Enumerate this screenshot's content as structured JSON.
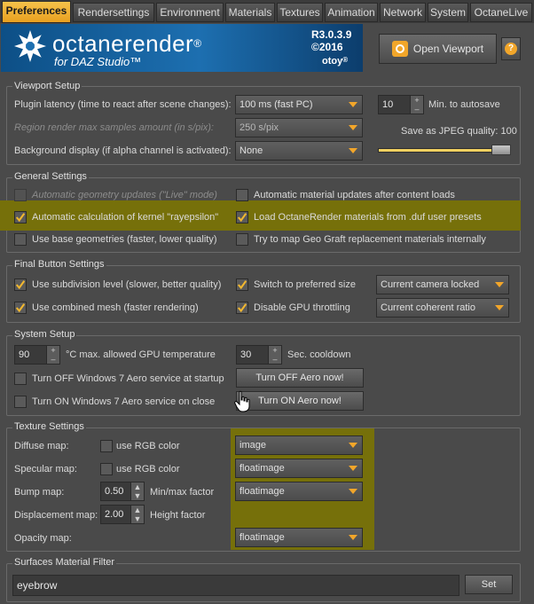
{
  "tabs": [
    {
      "label": "Preferences",
      "active": true
    },
    {
      "label": "Rendersettings"
    },
    {
      "label": "Environment"
    },
    {
      "label": "Materials"
    },
    {
      "label": "Textures"
    },
    {
      "label": "Animation"
    },
    {
      "label": "Network"
    },
    {
      "label": "System"
    },
    {
      "label": "OctaneLive"
    }
  ],
  "header": {
    "brand": "octanerender",
    "brand_reg": "®",
    "subtitle": "for DAZ Studio™",
    "version_line1": "R3.0.3.9",
    "version_line2": "©2016",
    "vendor": "otoy",
    "vendor_reg": "®",
    "open_viewport": "Open Viewport",
    "help": "?"
  },
  "viewport_setup": {
    "title": "Viewport Setup",
    "plugin_latency_label": "Plugin latency (time to react after scene changes):",
    "plugin_latency_value": "100 ms (fast PC)",
    "region_label": "Region render max samples amount (in s/pix):",
    "region_value": "250 s/pix",
    "background_label": "Background display (if alpha channel is activated):",
    "background_value": "None",
    "autosave_value": "10",
    "autosave_label": "Min. to autosave",
    "jpeg_label": "Save as JPEG quality: 100",
    "jpeg_quality": 100
  },
  "general_settings": {
    "title": "General Settings",
    "items": [
      {
        "label": "Automatic geometry updates (\"Live\" mode)",
        "checked": false,
        "disabled": true
      },
      {
        "label": "Automatic material updates after content loads",
        "checked": false
      },
      {
        "label": "Automatic calculation of kernel \"rayepsilon\"",
        "checked": true
      },
      {
        "label": "Load OctaneRender materials from .duf user presets",
        "checked": true
      },
      {
        "label": "Use base geometries (faster, lower quality)",
        "checked": false
      },
      {
        "label": "Try to map Geo Graft replacement materials internally",
        "checked": false
      }
    ]
  },
  "final_button": {
    "title": "Final Button Settings",
    "subdivision_label": "Use subdivision level (slower, better quality)",
    "switch_label": "Switch to preferred size",
    "camera_value": "Current camera locked",
    "combined_label": "Use combined mesh (faster rendering)",
    "gpu_label": "Disable GPU throttling",
    "ratio_value": "Current coherent ratio"
  },
  "system_setup": {
    "title": "System Setup",
    "gpu_temp_value": "90",
    "gpu_temp_label": "°C max. allowed GPU temperature",
    "cooldown_value": "30",
    "cooldown_label": "Sec. cooldown",
    "aero_off_label": "Turn OFF Windows 7 Aero service at startup",
    "aero_off_button": "Turn OFF Aero now!",
    "aero_on_label": "Turn ON Windows 7 Aero service on close",
    "aero_on_button": "Turn ON Aero now!"
  },
  "texture_settings": {
    "title": "Texture Settings",
    "diffuse_label": "Diffuse map:",
    "diffuse_rgb": "use RGB color",
    "diffuse_value": "image",
    "specular_label": "Specular map:",
    "specular_rgb": "use RGB color",
    "specular_value": "floatimage",
    "bump_label": "Bump map:",
    "bump_value": "0.50",
    "bump_factor_label": "Min/max factor",
    "bump_select": "floatimage",
    "displacement_label": "Displacement map:",
    "displacement_value": "2.00",
    "height_label": "Height factor",
    "opacity_label": "Opacity map:",
    "opacity_value": "floatimage"
  },
  "surfaces_filter": {
    "title": "Surfaces Material Filter",
    "value": "eyebrow",
    "set_button": "Set"
  },
  "colors": {
    "accent": "#f2a62a",
    "highlight": "#76700a",
    "banner": "#1d6fb0"
  }
}
